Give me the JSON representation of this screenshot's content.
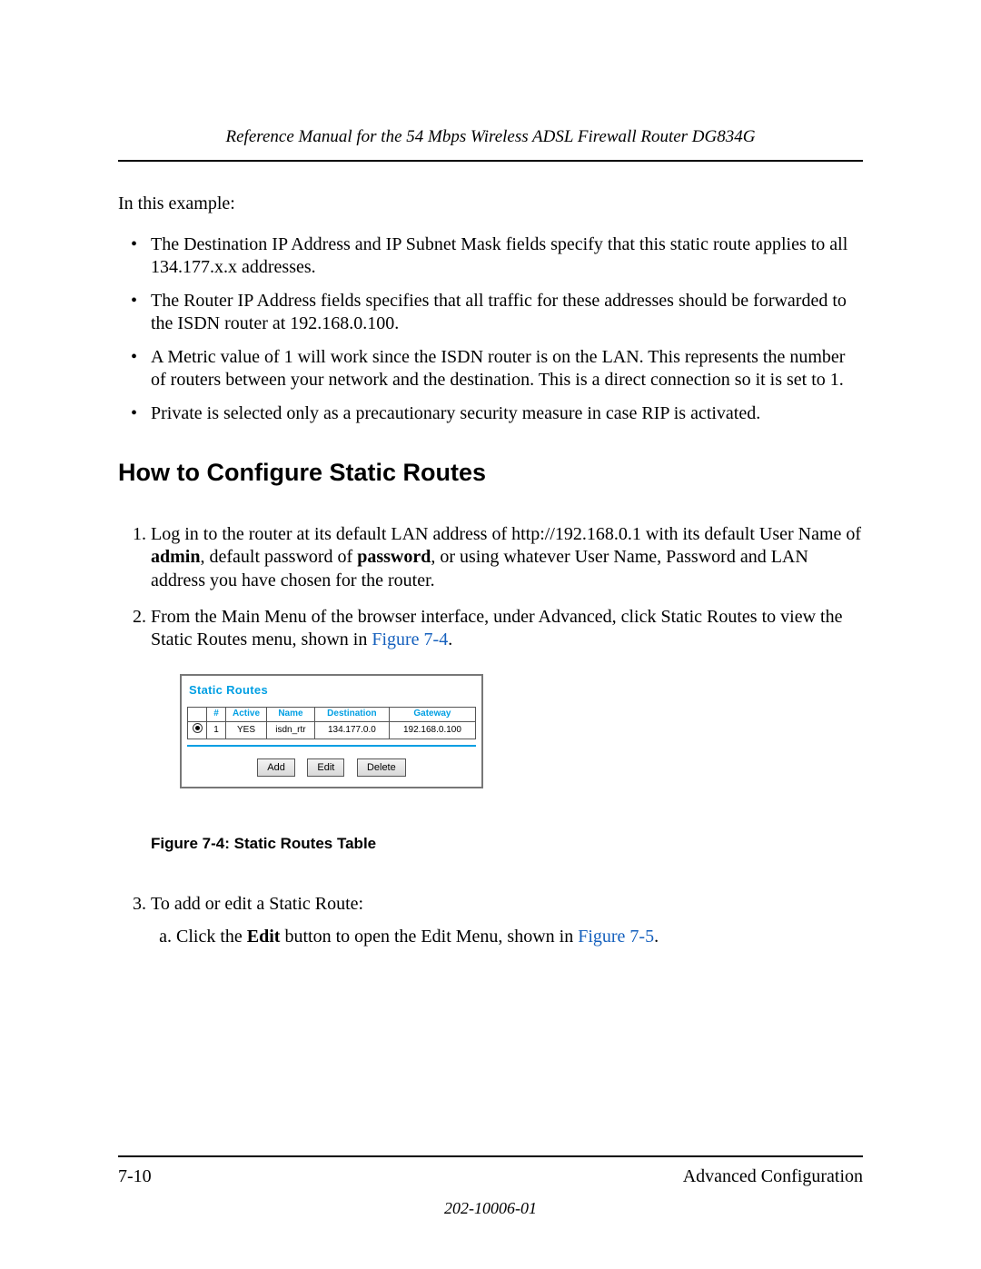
{
  "header": {
    "running_title": "Reference Manual for the 54 Mbps Wireless ADSL Firewall Router DG834G"
  },
  "intro": "In this example:",
  "bullets": [
    "The Destination IP Address and IP Subnet Mask fields specify that this static route applies to all 134.177.x.x addresses.",
    "The Router IP Address fields specifies that all traffic for these addresses should be forwarded to the ISDN router at 192.168.0.100.",
    "A Metric value of 1 will work since the ISDN router is on the LAN. This represents the number of routers between your network and the destination. This is a direct connection so it is set to 1.",
    "Private is selected only as a precautionary security measure in case RIP is activated."
  ],
  "section_heading": "How to Configure Static Routes",
  "steps": {
    "s1": {
      "pre": "Log in to the router at its default LAN address of http://192.168.0.1 with its default User Name of ",
      "b1": "admin",
      "mid": ", default password of ",
      "b2": "password",
      "post": ", or using whatever User Name, Password and LAN address you have chosen for the router."
    },
    "s2": {
      "pre": "From the Main Menu of the browser interface, under Advanced, click Static Routes to view the Static Routes menu, shown in ",
      "xref": "Figure 7-4",
      "post": "."
    },
    "s3": {
      "text": "To add or edit a Static Route:",
      "a": {
        "pre": "Click the ",
        "b": "Edit",
        "mid": " button to open the Edit Menu, shown in ",
        "xref": "Figure 7-5",
        "post": "."
      }
    }
  },
  "figure": {
    "panel_title": "Static Routes",
    "headers": {
      "sel": "",
      "num": "#",
      "active": "Active",
      "name": "Name",
      "dest": "Destination",
      "gw": "Gateway"
    },
    "row": {
      "num": "1",
      "active": "YES",
      "name": "isdn_rtr",
      "dest": "134.177.0.0",
      "gw": "192.168.0.100"
    },
    "buttons": {
      "add": "Add",
      "edit": "Edit",
      "delete": "Delete"
    },
    "caption": "Figure 7-4:  Static Routes Table"
  },
  "footer": {
    "page_num": "7-10",
    "section": "Advanced Configuration",
    "doc_number": "202-10006-01"
  }
}
